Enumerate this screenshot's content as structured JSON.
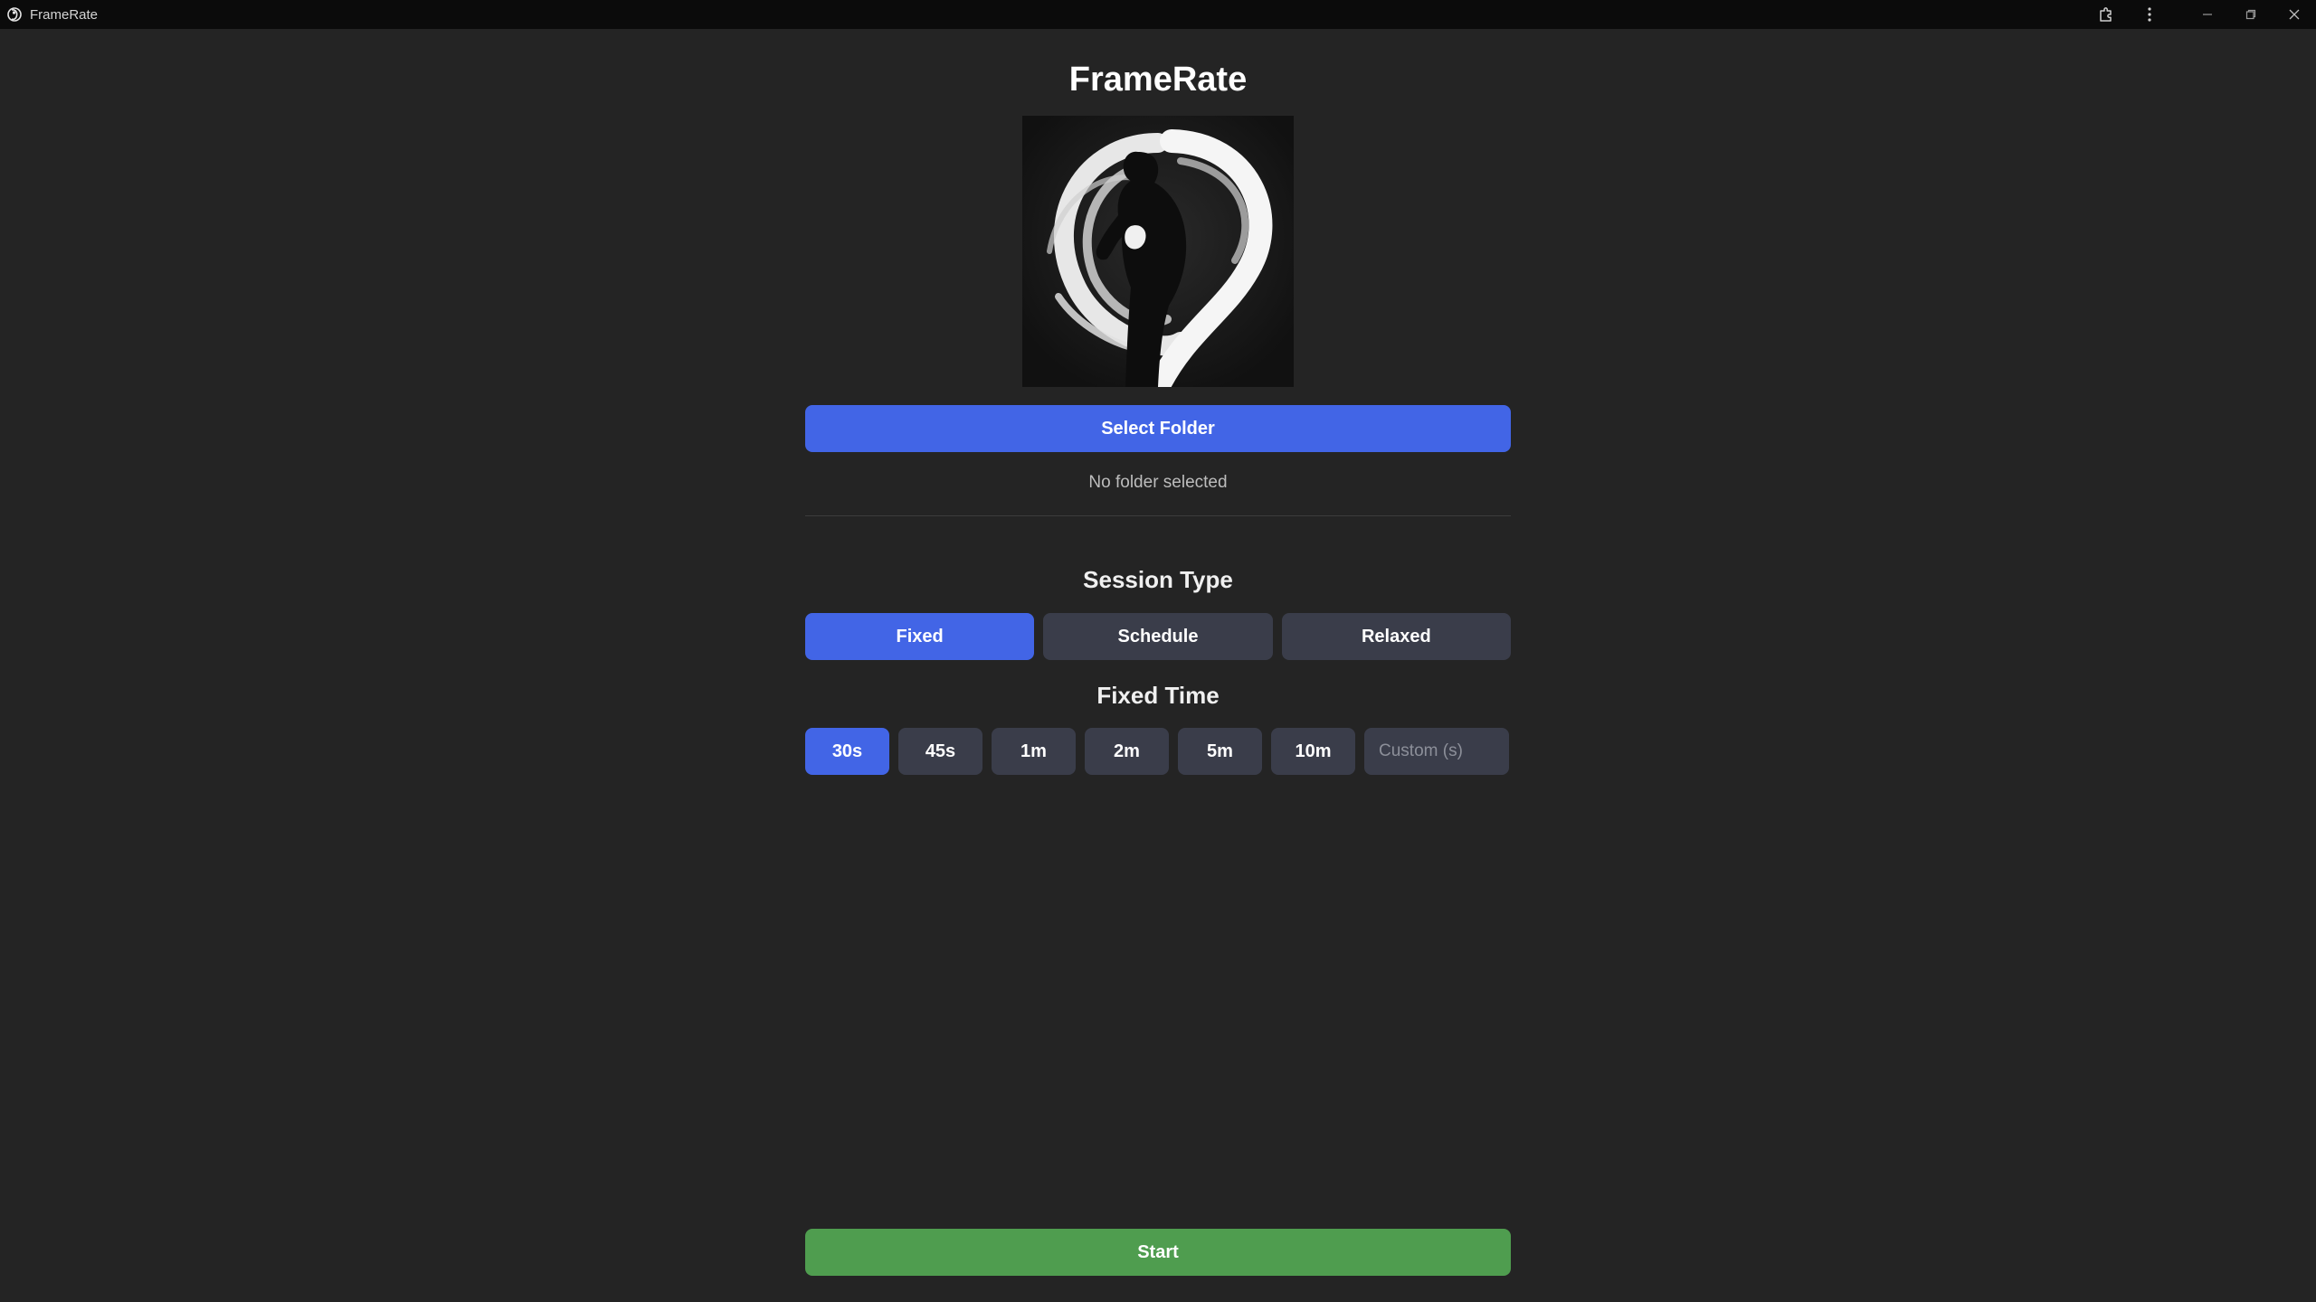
{
  "window": {
    "app_name": "FrameRate"
  },
  "header": {
    "title": "FrameRate"
  },
  "folder": {
    "select_label": "Select Folder",
    "status": "No folder selected"
  },
  "session": {
    "title": "Session Type",
    "options": [
      "Fixed",
      "Schedule",
      "Relaxed"
    ],
    "selected": "Fixed"
  },
  "fixed_time": {
    "title": "Fixed Time",
    "options": [
      "30s",
      "45s",
      "1m",
      "2m",
      "5m",
      "10m"
    ],
    "selected": "30s",
    "custom_placeholder": "Custom (s)",
    "custom_value": ""
  },
  "actions": {
    "start_label": "Start"
  },
  "colors": {
    "background": "#242424",
    "titlebar": "#0b0b0b",
    "accent": "#4265e6",
    "inactive_button": "#3a3d4a",
    "start": "#4f9d4f"
  },
  "icons": {
    "app": "framerate-logo-icon",
    "extensions": "puzzle-icon",
    "menu": "kebab-menu-icon",
    "minimize": "minimize-icon",
    "maximize": "restore-icon",
    "close": "close-icon"
  }
}
